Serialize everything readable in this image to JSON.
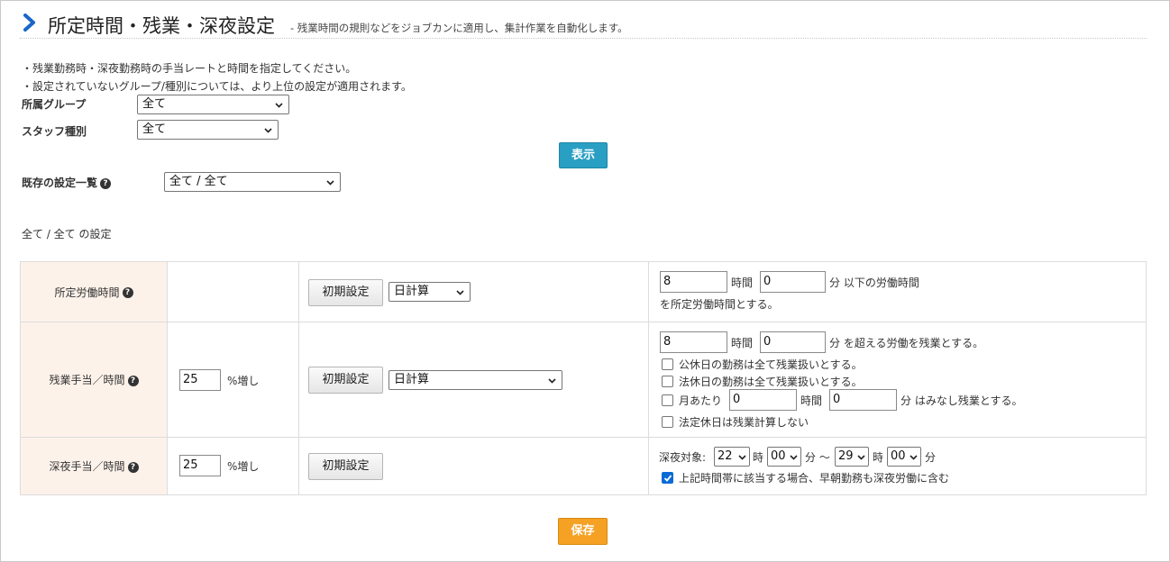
{
  "header": {
    "title": "所定時間・残業・深夜設定",
    "subtitle": "- 残業時間の規則などをジョブカンに適用し、集計作業を自動化します。"
  },
  "notes": [
    "・残業勤務時・深夜勤務時の手当レートと時間を指定してください。",
    "・設定されていないグループ/種別については、より上位の設定が適用されます。"
  ],
  "filters": {
    "group_label": "所属グループ",
    "group_value": "全て",
    "staff_label": "スタッフ種別",
    "staff_value": "全て",
    "show_button": "表示",
    "existing_label": "既存の設定一覧",
    "existing_value": "全て / 全て"
  },
  "section_title": "全て / 全て の設定",
  "rows": {
    "scheduled": {
      "label": "所定労働時間",
      "init_button": "初期設定",
      "calc_value": "日計算",
      "hours": "8",
      "hours_unit": "時間",
      "minutes": "0",
      "tail": "分 以下の労働時間",
      "line2": "を所定労働時間とする。"
    },
    "overtime": {
      "label": "残業手当／時間",
      "rate": "25",
      "rate_unit": "%増し",
      "init_button": "初期設定",
      "calc_value": "日計算",
      "hours": "8",
      "hours_unit": "時間",
      "minutes": "0",
      "tail": "分 を超える労働を残業とする。",
      "check1": "公休日の勤務は全て残業扱いとする。",
      "check2": "法休日の勤務は全て残業扱いとする。",
      "check3_pre": "月あたり",
      "check3_hours": "0",
      "check3_hours_unit": "時間",
      "check3_minutes": "0",
      "check3_tail": "分 はみなし残業とする。",
      "check4": "法定休日は残業計算しない"
    },
    "night": {
      "label": "深夜手当／時間",
      "rate": "25",
      "rate_unit": "%増し",
      "init_button": "初期設定",
      "target_label": "深夜対象:",
      "from_hour": "22",
      "hour_unit": "時",
      "from_min": "00",
      "min_unit_tilde": "分 〜",
      "to_hour": "29",
      "to_min": "00",
      "min_unit": "分",
      "check": "上記時間帯に該当する場合、早朝勤務も深夜労働に含む"
    }
  },
  "save_button": "保存",
  "colors": {
    "accent": "#1a66c9",
    "primary_button": "#2a9fc4",
    "save_button": "#f5a123",
    "header_cell": "#fdf2ea",
    "checkbox_on": "#0a6ad6"
  }
}
